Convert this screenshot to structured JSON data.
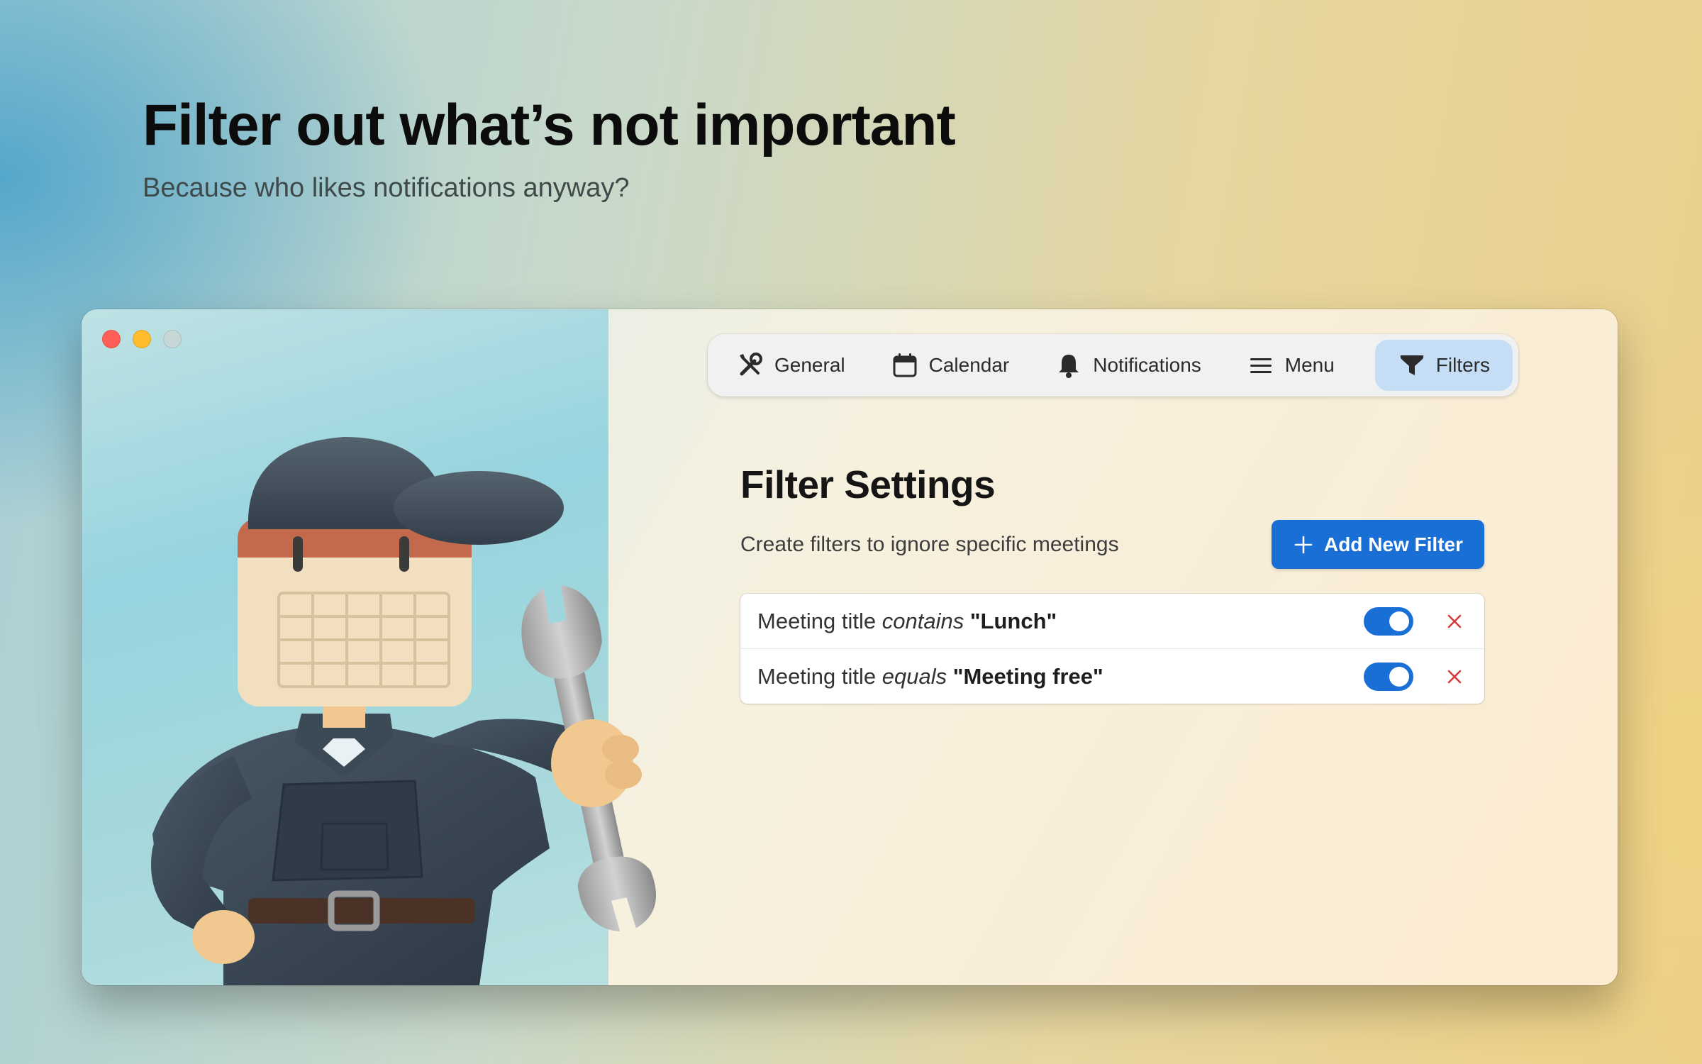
{
  "hero": {
    "title": "Filter out what’s not important",
    "subtitle": "Because who likes notifications anyway?"
  },
  "window": {
    "traffic_lights": [
      "close",
      "minimize",
      "zoom-disabled"
    ],
    "illustration": "mechanic-calendar-mascot-with-wrench"
  },
  "tabs": [
    {
      "label": "General",
      "icon": "wrench-screwdriver-icon",
      "active": false
    },
    {
      "label": "Calendar",
      "icon": "calendar-icon",
      "active": false
    },
    {
      "label": "Notifications",
      "icon": "bell-icon",
      "active": false
    },
    {
      "label": "Menu",
      "icon": "hamburger-menu-icon",
      "active": false
    },
    {
      "label": "Filters",
      "icon": "funnel-icon",
      "active": true
    }
  ],
  "settings": {
    "title": "Filter Settings",
    "subtitle": "Create filters to ignore specific meetings",
    "add_button": "Add New Filter"
  },
  "filters": [
    {
      "field": "Meeting title",
      "operator": "contains",
      "value": "\"Lunch\"",
      "enabled": true
    },
    {
      "field": "Meeting title",
      "operator": "equals",
      "value": "\"Meeting free\"",
      "enabled": true
    }
  ],
  "colors": {
    "accent": "#1a6fd6",
    "active_tab": "#c6def5",
    "delete": "#d63a3a",
    "close": "#ff5f57",
    "minimize": "#febc2e"
  }
}
